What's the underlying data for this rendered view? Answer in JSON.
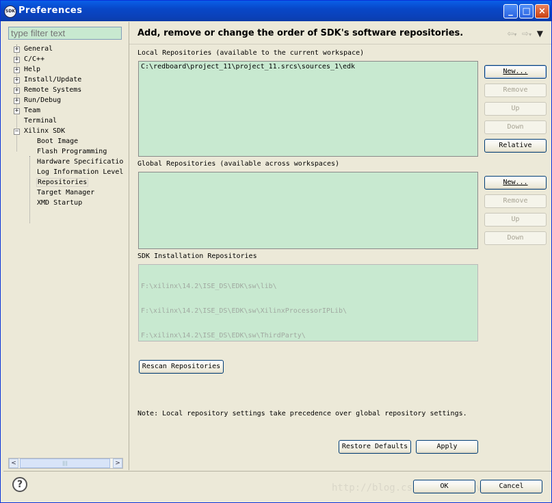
{
  "window": {
    "title": "Preferences",
    "app_icon_text": "SDK"
  },
  "filter": {
    "placeholder": "type filter text"
  },
  "tree": {
    "top_items": [
      "General",
      "C/C++",
      "Help",
      "Install/Update",
      "Remote Systems",
      "Run/Debug",
      "Team",
      "Terminal",
      "Xilinx SDK"
    ],
    "xilinx_children": [
      "Boot Image",
      "Flash Programming",
      "Hardware Specificatio",
      "Log Information Level",
      "Repositories",
      "Target Manager",
      "XMD Startup"
    ],
    "selected": "Repositories"
  },
  "page": {
    "heading": "Add, remove or change the order of SDK's software repositories.",
    "local_label": "Local Repositories (available to the current workspace)",
    "local_items": [
      "C:\\redboard\\project_11\\project_11.srcs\\sources_1\\edk"
    ],
    "global_label": "Global Repositories (available across workspaces)",
    "global_items": [],
    "sdk_label": "SDK Installation Repositories",
    "sdk_items": [
      "F:\\xilinx\\14.2\\ISE_DS\\EDK\\sw\\lib\\",
      "F:\\xilinx\\14.2\\ISE_DS\\EDK\\sw\\XilinxProcessorIPLib\\",
      "F:\\xilinx\\14.2\\ISE_DS\\EDK\\sw\\ThirdParty\\"
    ],
    "rescan_label": "Rescan Repositories",
    "note": "Note: Local repository settings take precedence over global repository settings."
  },
  "local_buttons": {
    "new": "New...",
    "remove": "Remove",
    "up": "Up",
    "down": "Down",
    "relative": "Relative"
  },
  "global_buttons": {
    "new": "New...",
    "remove": "Remove",
    "up": "Up",
    "down": "Down"
  },
  "footer": {
    "restore_defaults": "Restore Defaults",
    "apply": "Apply",
    "ok": "OK",
    "cancel": "Cancel",
    "watermark": "http://blog.csdn.net/xxyyvvvson"
  },
  "colors": {
    "list_bg": "#c8e9d0",
    "titlebar": "#0a5fe8",
    "dialog_bg": "#ece9d8"
  }
}
